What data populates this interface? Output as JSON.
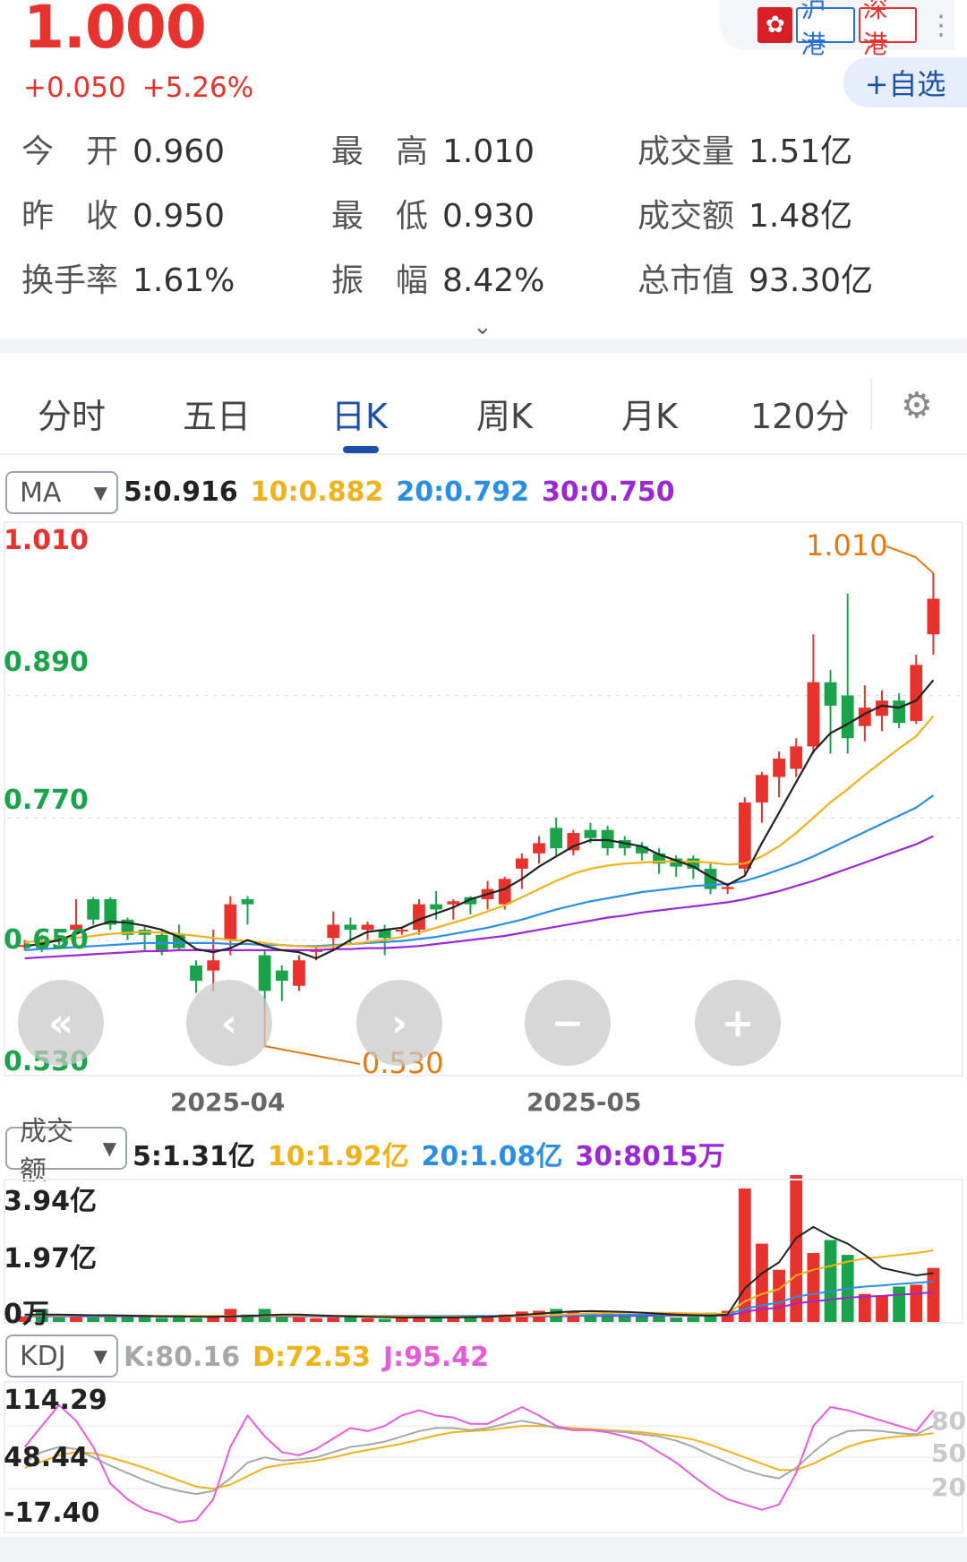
{
  "quote": {
    "price": "1.000",
    "change": "+0.050",
    "change_pct": "+5.26%",
    "flag_icon": "hong-kong-flag-icon",
    "tag_sh": "沪港",
    "tag_sz": "深港",
    "add_watch": "+自选"
  },
  "stats": {
    "open_label": "今　开",
    "open": "0.960",
    "high_label": "最　高",
    "high": "1.010",
    "volume_label": "成交量",
    "volume": "1.51亿",
    "prev_close_label": "昨　收",
    "prev_close": "0.950",
    "low_label": "最　低",
    "low": "0.930",
    "amount_label": "成交额",
    "amount": "1.48亿",
    "turnover_label": "换手率",
    "turnover": "1.61%",
    "amplitude_label": "振　幅",
    "amplitude": "8.42%",
    "mktcap_label": "总市值",
    "mktcap": "93.30亿"
  },
  "tabs": [
    "分时",
    "五日",
    "日K",
    "周K",
    "月K",
    "120分"
  ],
  "active_tab": "日K",
  "ma": {
    "selector": "MA",
    "ma5": "5:0.916",
    "ma10": "10:0.882",
    "ma20": "20:0.792",
    "ma30": "30:0.750"
  },
  "amount_ind": {
    "selector": "成交额",
    "ma5": "5:1.31亿",
    "ma10": "10:1.92亿",
    "ma20": "20:1.08亿",
    "ma30": "30:8015万"
  },
  "kdj": {
    "selector": "KDJ",
    "k": "K:80.16",
    "d": "D:72.53",
    "j": "J:95.42"
  },
  "colors": {
    "up": "#e8322d",
    "down": "#1aa34a",
    "ma5": "#222222",
    "ma10": "#f0b21b",
    "ma20": "#2a8ee6",
    "ma30": "#9b27d6",
    "j": "#e55bdc",
    "k": "#a7a7a7",
    "d": "#f0b21b",
    "accent": "#1d4fa8",
    "annotation": "#e07a14"
  },
  "chart_data": [
    {
      "type": "candlestick",
      "title": "",
      "y_ticks": [
        "1.010",
        "0.890",
        "0.770",
        "0.650",
        "0.530"
      ],
      "x_ticks": [
        "2025-04",
        "2025-05"
      ],
      "ylim": [
        0.53,
        1.01
      ],
      "annotations": {
        "max": "1.010",
        "min": "0.530"
      },
      "candles": [
        {
          "o": 0.645,
          "c": 0.645,
          "h": 0.65,
          "l": 0.64
        },
        {
          "o": 0.65,
          "c": 0.642,
          "h": 0.655,
          "l": 0.638
        },
        {
          "o": 0.65,
          "c": 0.648,
          "h": 0.655,
          "l": 0.645
        },
        {
          "o": 0.66,
          "c": 0.665,
          "h": 0.69,
          "l": 0.655
        },
        {
          "o": 0.69,
          "c": 0.67,
          "h": 0.692,
          "l": 0.665
        },
        {
          "o": 0.69,
          "c": 0.665,
          "h": 0.692,
          "l": 0.66
        },
        {
          "o": 0.67,
          "c": 0.655,
          "h": 0.672,
          "l": 0.65
        },
        {
          "o": 0.66,
          "c": 0.655,
          "h": 0.663,
          "l": 0.64
        },
        {
          "o": 0.655,
          "c": 0.64,
          "h": 0.66,
          "l": 0.635
        },
        {
          "o": 0.655,
          "c": 0.642,
          "h": 0.665,
          "l": 0.64
        },
        {
          "o": 0.625,
          "c": 0.61,
          "h": 0.63,
          "l": 0.598
        },
        {
          "o": 0.62,
          "c": 0.63,
          "h": 0.66,
          "l": 0.6
        },
        {
          "o": 0.65,
          "c": 0.685,
          "h": 0.693,
          "l": 0.635
        },
        {
          "o": 0.69,
          "c": 0.685,
          "h": 0.693,
          "l": 0.665
        },
        {
          "o": 0.635,
          "c": 0.6,
          "h": 0.64,
          "l": 0.585
        },
        {
          "o": 0.62,
          "c": 0.61,
          "h": 0.625,
          "l": 0.59
        },
        {
          "o": 0.605,
          "c": 0.63,
          "h": 0.635,
          "l": 0.6
        },
        {
          "o": 0.64,
          "c": 0.64,
          "h": 0.643,
          "l": 0.63
        },
        {
          "o": 0.652,
          "c": 0.665,
          "h": 0.678,
          "l": 0.64
        },
        {
          "o": 0.665,
          "c": 0.66,
          "h": 0.672,
          "l": 0.645
        },
        {
          "o": 0.66,
          "c": 0.665,
          "h": 0.668,
          "l": 0.65
        },
        {
          "o": 0.66,
          "c": 0.652,
          "h": 0.665,
          "l": 0.635
        },
        {
          "o": 0.66,
          "c": 0.66,
          "h": 0.663,
          "l": 0.655
        },
        {
          "o": 0.66,
          "c": 0.685,
          "h": 0.69,
          "l": 0.655
        },
        {
          "o": 0.685,
          "c": 0.68,
          "h": 0.698,
          "l": 0.67
        },
        {
          "o": 0.685,
          "c": 0.688,
          "h": 0.69,
          "l": 0.67
        },
        {
          "o": 0.692,
          "c": 0.685,
          "h": 0.693,
          "l": 0.675
        },
        {
          "o": 0.69,
          "c": 0.7,
          "h": 0.708,
          "l": 0.68
        },
        {
          "o": 0.685,
          "c": 0.71,
          "h": 0.712,
          "l": 0.68
        },
        {
          "o": 0.72,
          "c": 0.73,
          "h": 0.735,
          "l": 0.7
        },
        {
          "o": 0.735,
          "c": 0.745,
          "h": 0.752,
          "l": 0.725
        },
        {
          "o": 0.76,
          "c": 0.74,
          "h": 0.77,
          "l": 0.733
        },
        {
          "o": 0.738,
          "c": 0.755,
          "h": 0.758,
          "l": 0.733
        },
        {
          "o": 0.758,
          "c": 0.75,
          "h": 0.765,
          "l": 0.745
        },
        {
          "o": 0.758,
          "c": 0.74,
          "h": 0.762,
          "l": 0.733
        },
        {
          "o": 0.748,
          "c": 0.74,
          "h": 0.752,
          "l": 0.733
        },
        {
          "o": 0.742,
          "c": 0.735,
          "h": 0.746,
          "l": 0.728
        },
        {
          "o": 0.735,
          "c": 0.725,
          "h": 0.74,
          "l": 0.715
        },
        {
          "o": 0.73,
          "c": 0.722,
          "h": 0.733,
          "l": 0.712
        },
        {
          "o": 0.73,
          "c": 0.72,
          "h": 0.733,
          "l": 0.71
        },
        {
          "o": 0.72,
          "c": 0.7,
          "h": 0.725,
          "l": 0.695
        },
        {
          "o": 0.7,
          "c": 0.702,
          "h": 0.705,
          "l": 0.695
        },
        {
          "o": 0.72,
          "c": 0.785,
          "h": 0.79,
          "l": 0.715
        },
        {
          "o": 0.785,
          "c": 0.812,
          "h": 0.815,
          "l": 0.765
        },
        {
          "o": 0.81,
          "c": 0.828,
          "h": 0.835,
          "l": 0.79
        },
        {
          "o": 0.818,
          "c": 0.84,
          "h": 0.848,
          "l": 0.81
        },
        {
          "o": 0.84,
          "c": 0.903,
          "h": 0.95,
          "l": 0.833
        },
        {
          "o": 0.903,
          "c": 0.88,
          "h": 0.915,
          "l": 0.833
        },
        {
          "o": 0.89,
          "c": 0.848,
          "h": 0.99,
          "l": 0.833
        },
        {
          "o": 0.86,
          "c": 0.878,
          "h": 0.9,
          "l": 0.845
        },
        {
          "o": 0.87,
          "c": 0.885,
          "h": 0.895,
          "l": 0.855
        },
        {
          "o": 0.885,
          "c": 0.863,
          "h": 0.892,
          "l": 0.858
        },
        {
          "o": 0.865,
          "c": 0.92,
          "h": 0.93,
          "l": 0.862
        },
        {
          "o": 0.95,
          "c": 0.985,
          "h": 1.01,
          "l": 0.93
        }
      ],
      "ma5": [
        0.644,
        0.646,
        0.65,
        0.656,
        0.663,
        0.668,
        0.667,
        0.664,
        0.66,
        0.653,
        0.641,
        0.638,
        0.642,
        0.65,
        0.644,
        0.64,
        0.638,
        0.632,
        0.64,
        0.65,
        0.658,
        0.66,
        0.662,
        0.67,
        0.676,
        0.682,
        0.69,
        0.695,
        0.7,
        0.71,
        0.722,
        0.732,
        0.742,
        0.748,
        0.748,
        0.745,
        0.742,
        0.734,
        0.728,
        0.722,
        0.712,
        0.704,
        0.713,
        0.745,
        0.775,
        0.805,
        0.835,
        0.853,
        0.862,
        0.872,
        0.88,
        0.878,
        0.885,
        0.905
      ],
      "ma10": [
        0.648,
        0.649,
        0.65,
        0.652,
        0.654,
        0.656,
        0.657,
        0.658,
        0.657,
        0.656,
        0.654,
        0.652,
        0.65,
        0.649,
        0.647,
        0.645,
        0.644,
        0.643,
        0.644,
        0.646,
        0.648,
        0.65,
        0.653,
        0.657,
        0.662,
        0.667,
        0.672,
        0.678,
        0.684,
        0.692,
        0.7,
        0.708,
        0.715,
        0.72,
        0.723,
        0.725,
        0.726,
        0.727,
        0.727,
        0.727,
        0.726,
        0.724,
        0.725,
        0.732,
        0.742,
        0.755,
        0.77,
        0.785,
        0.798,
        0.812,
        0.825,
        0.838,
        0.85,
        0.87
      ],
      "ma20": [
        0.64,
        0.641,
        0.642,
        0.643,
        0.644,
        0.645,
        0.646,
        0.647,
        0.647,
        0.647,
        0.647,
        0.647,
        0.646,
        0.646,
        0.645,
        0.645,
        0.644,
        0.644,
        0.645,
        0.646,
        0.647,
        0.648,
        0.649,
        0.651,
        0.653,
        0.656,
        0.659,
        0.662,
        0.666,
        0.67,
        0.675,
        0.68,
        0.684,
        0.688,
        0.691,
        0.694,
        0.697,
        0.699,
        0.701,
        0.703,
        0.704,
        0.705,
        0.708,
        0.713,
        0.719,
        0.725,
        0.732,
        0.74,
        0.748,
        0.756,
        0.764,
        0.772,
        0.78,
        0.792
      ],
      "ma30": [
        0.632,
        0.633,
        0.634,
        0.635,
        0.636,
        0.637,
        0.638,
        0.639,
        0.639,
        0.64,
        0.64,
        0.64,
        0.64,
        0.64,
        0.64,
        0.64,
        0.64,
        0.64,
        0.641,
        0.641,
        0.642,
        0.642,
        0.643,
        0.644,
        0.646,
        0.648,
        0.65,
        0.652,
        0.654,
        0.657,
        0.66,
        0.663,
        0.666,
        0.669,
        0.672,
        0.674,
        0.677,
        0.679,
        0.681,
        0.683,
        0.685,
        0.687,
        0.69,
        0.694,
        0.698,
        0.703,
        0.708,
        0.714,
        0.72,
        0.726,
        0.732,
        0.738,
        0.744,
        0.752
      ]
    },
    {
      "type": "bar",
      "title": "",
      "y_ticks": [
        "3.94亿",
        "1.97亿",
        "0万"
      ],
      "ylim": [
        0,
        3.94
      ],
      "values": [
        0.15,
        0.35,
        0.12,
        0.18,
        0.12,
        0.14,
        0.13,
        0.13,
        0.11,
        0.12,
        0.1,
        0.12,
        0.35,
        0.2,
        0.35,
        0.18,
        0.12,
        0.1,
        0.12,
        0.15,
        0.1,
        0.08,
        0.1,
        0.12,
        0.1,
        0.12,
        0.15,
        0.18,
        0.2,
        0.28,
        0.3,
        0.35,
        0.3,
        0.25,
        0.28,
        0.22,
        0.18,
        0.15,
        0.12,
        0.14,
        0.25,
        0.3,
        3.58,
        2.1,
        1.4,
        3.94,
        1.85,
        2.2,
        1.8,
        0.75,
        0.7,
        0.95,
        1.0,
        1.45
      ],
      "ma5": [
        0.2,
        0.2,
        0.2,
        0.19,
        0.18,
        0.18,
        0.17,
        0.16,
        0.15,
        0.15,
        0.14,
        0.14,
        0.15,
        0.16,
        0.18,
        0.2,
        0.2,
        0.18,
        0.16,
        0.15,
        0.14,
        0.13,
        0.12,
        0.12,
        0.12,
        0.12,
        0.13,
        0.14,
        0.16,
        0.19,
        0.22,
        0.26,
        0.28,
        0.29,
        0.28,
        0.27,
        0.25,
        0.22,
        0.2,
        0.18,
        0.17,
        0.2,
        0.9,
        1.3,
        1.6,
        2.25,
        2.55,
        2.3,
        2.1,
        1.8,
        1.45,
        1.35,
        1.25,
        1.31
      ],
      "ma10": [
        0.18,
        0.18,
        0.18,
        0.18,
        0.18,
        0.17,
        0.17,
        0.17,
        0.16,
        0.16,
        0.16,
        0.16,
        0.16,
        0.16,
        0.16,
        0.17,
        0.17,
        0.17,
        0.17,
        0.16,
        0.16,
        0.15,
        0.15,
        0.14,
        0.14,
        0.14,
        0.14,
        0.14,
        0.15,
        0.16,
        0.17,
        0.19,
        0.21,
        0.23,
        0.24,
        0.25,
        0.25,
        0.25,
        0.24,
        0.23,
        0.22,
        0.22,
        0.55,
        0.75,
        0.88,
        1.25,
        1.4,
        1.5,
        1.62,
        1.7,
        1.75,
        1.8,
        1.85,
        1.92
      ],
      "ma20": [
        0.16,
        0.16,
        0.16,
        0.16,
        0.16,
        0.16,
        0.16,
        0.16,
        0.16,
        0.16,
        0.16,
        0.16,
        0.16,
        0.16,
        0.16,
        0.16,
        0.16,
        0.16,
        0.16,
        0.16,
        0.16,
        0.16,
        0.16,
        0.16,
        0.16,
        0.16,
        0.16,
        0.16,
        0.16,
        0.16,
        0.17,
        0.17,
        0.18,
        0.18,
        0.19,
        0.19,
        0.2,
        0.2,
        0.2,
        0.2,
        0.2,
        0.21,
        0.35,
        0.45,
        0.52,
        0.68,
        0.75,
        0.82,
        0.9,
        0.95,
        0.98,
        1.02,
        1.05,
        1.08
      ],
      "ma30": [
        0.15,
        0.15,
        0.15,
        0.15,
        0.15,
        0.15,
        0.15,
        0.15,
        0.15,
        0.15,
        0.15,
        0.15,
        0.15,
        0.15,
        0.15,
        0.15,
        0.15,
        0.15,
        0.15,
        0.15,
        0.15,
        0.15,
        0.15,
        0.15,
        0.15,
        0.15,
        0.15,
        0.15,
        0.15,
        0.15,
        0.15,
        0.15,
        0.16,
        0.16,
        0.16,
        0.16,
        0.16,
        0.17,
        0.17,
        0.17,
        0.17,
        0.17,
        0.27,
        0.34,
        0.38,
        0.5,
        0.55,
        0.6,
        0.65,
        0.68,
        0.7,
        0.73,
        0.76,
        0.8
      ]
    },
    {
      "type": "line",
      "title": "",
      "y_ticks": [
        "114.29",
        "48.44",
        "-17.40"
      ],
      "right_ticks": [
        "80",
        "50",
        "20"
      ],
      "ylim": [
        -17.4,
        114.29
      ],
      "K": [
        45,
        55,
        60,
        58,
        50,
        42,
        35,
        28,
        22,
        18,
        15,
        18,
        30,
        45,
        50,
        47,
        48,
        50,
        55,
        60,
        62,
        65,
        70,
        75,
        78,
        78,
        76,
        78,
        82,
        85,
        82,
        78,
        76,
        76,
        75,
        74,
        72,
        70,
        66,
        60,
        52,
        45,
        38,
        33,
        30,
        40,
        55,
        68,
        75,
        76,
        75,
        73,
        72,
        80
      ],
      "D": [
        40,
        46,
        52,
        55,
        54,
        50,
        45,
        40,
        34,
        28,
        22,
        20,
        24,
        32,
        40,
        43,
        45,
        47,
        50,
        54,
        57,
        60,
        63,
        67,
        71,
        74,
        75,
        76,
        78,
        80,
        80,
        79,
        78,
        77,
        76,
        75,
        74,
        72,
        70,
        67,
        62,
        56,
        50,
        44,
        38,
        38,
        44,
        52,
        60,
        65,
        68,
        70,
        71,
        73
      ],
      "J": [
        60,
        80,
        100,
        85,
        60,
        25,
        10,
        0,
        -5,
        -12,
        -10,
        10,
        60,
        90,
        70,
        55,
        52,
        58,
        68,
        78,
        75,
        80,
        90,
        95,
        90,
        88,
        82,
        82,
        90,
        98,
        90,
        80,
        76,
        76,
        74,
        70,
        65,
        55,
        45,
        32,
        20,
        10,
        5,
        0,
        5,
        35,
        80,
        98,
        95,
        90,
        85,
        80,
        75,
        95
      ]
    }
  ]
}
